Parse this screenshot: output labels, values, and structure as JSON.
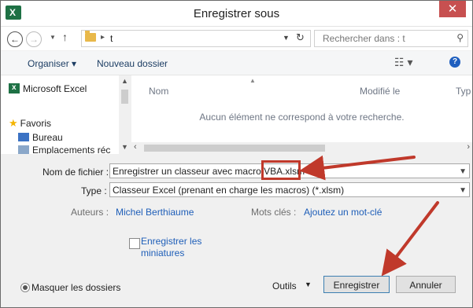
{
  "window": {
    "title": "Enregistrer sous",
    "close_glyph": "✕"
  },
  "nav": {
    "path_arrow": "▸",
    "path_folder": "t",
    "search_placeholder": "Rechercher dans : t"
  },
  "toolbar": {
    "organize": "Organiser ▾",
    "new_folder": "Nouveau dossier"
  },
  "tree": [
    {
      "label": "Microsoft Excel"
    },
    {
      "label": "Favoris"
    },
    {
      "label": "Bureau"
    },
    {
      "label": "Emplacements réc"
    }
  ],
  "columns": {
    "name": "Nom",
    "modified": "Modifié le",
    "type": "Typ"
  },
  "empty_message": "Aucun élément ne correspond à votre recherche.",
  "form": {
    "filename_label": "Nom de fichier :",
    "filename_value": "Enregistrer un classeur avec macro VBA.xlsm",
    "type_label": "Type :",
    "type_value": "Classeur Excel (prenant en charge les macros) (*.xlsm)",
    "authors_label": "Auteurs :",
    "authors_value": "Michel Berthiaume",
    "keywords_label": "Mots clés :",
    "keywords_value": "Ajoutez un mot-clé",
    "thumbnails_label": "Enregistrer les miniatures"
  },
  "footer": {
    "hide_folders": "Masquer les dossiers",
    "tools": "Outils",
    "save": "Enregistrer",
    "cancel": "Annuler"
  },
  "colors": {
    "accent_link": "#1e5eb8",
    "annotation": "#c0392b",
    "excel_green": "#1e7145"
  }
}
